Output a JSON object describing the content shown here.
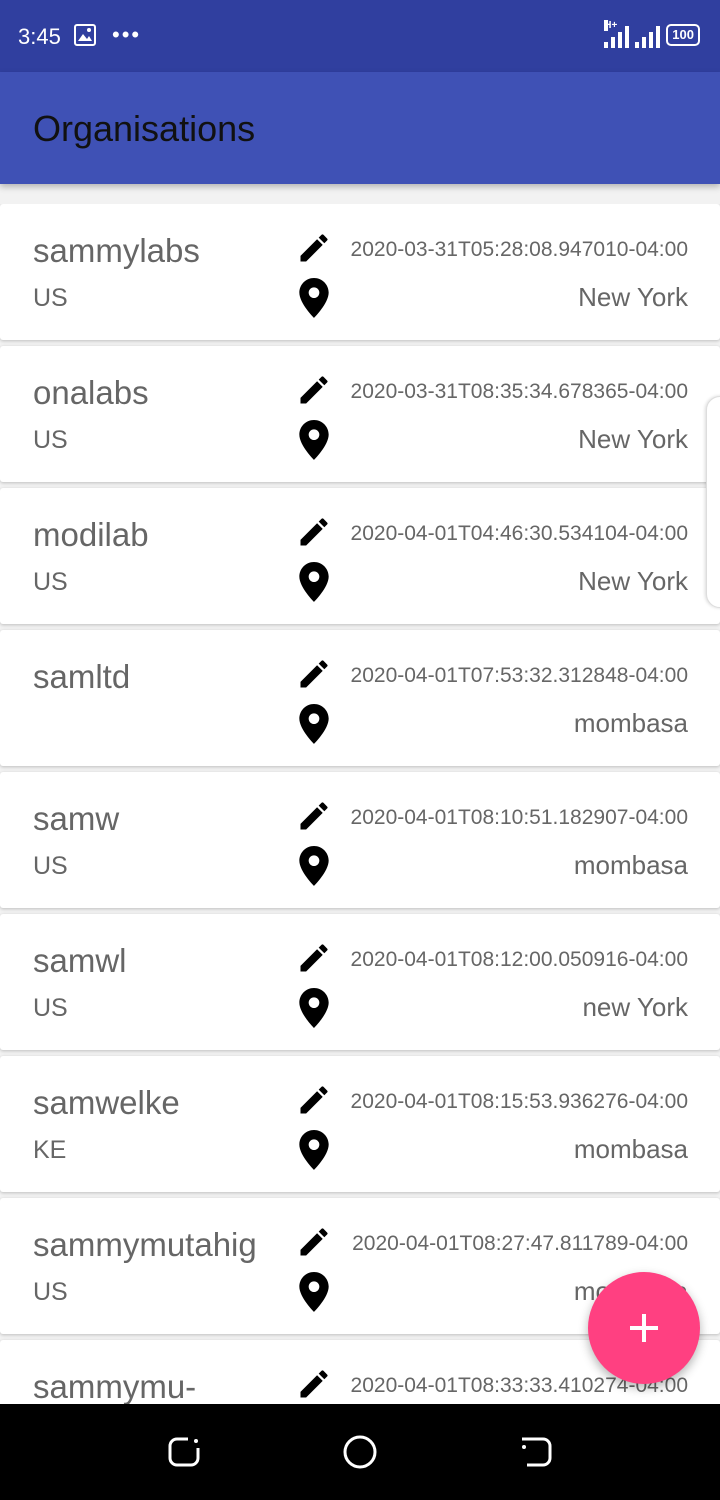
{
  "status_bar": {
    "time": "3:45",
    "dots": "•••",
    "network_type": "H+",
    "battery": "100"
  },
  "app_bar": {
    "title": "Organisations"
  },
  "organisations": [
    {
      "name": "sammylabs",
      "country": "US",
      "timestamp": "2020-03-31T05:28:08.947010-04:00",
      "location": "New York"
    },
    {
      "name": "onalabs",
      "country": "US",
      "timestamp": "2020-03-31T08:35:34.678365-04:00",
      "location": "New York"
    },
    {
      "name": "modilab",
      "country": "US",
      "timestamp": "2020-04-01T04:46:30.534104-04:00",
      "location": "New York"
    },
    {
      "name": "samltd",
      "country": "",
      "timestamp": "2020-04-01T07:53:32.312848-04:00",
      "location": "mombasa"
    },
    {
      "name": "samw",
      "country": "US",
      "timestamp": "2020-04-01T08:10:51.182907-04:00",
      "location": "mombasa"
    },
    {
      "name": "samwl",
      "country": "US",
      "timestamp": "2020-04-01T08:12:00.050916-04:00",
      "location": "new York"
    },
    {
      "name": "samwelke",
      "country": "KE",
      "timestamp": "2020-04-01T08:15:53.936276-04:00",
      "location": "mombasa"
    },
    {
      "name": "sammymutahig",
      "country": "US",
      "timestamp": "2020-04-01T08:27:47.811789-04:00",
      "location": "mombasa"
    },
    {
      "name": "sammymu-",
      "country": "",
      "timestamp": "2020-04-01T08:33:33.410274-04:00",
      "location": ""
    }
  ],
  "icons": {
    "edit": "pencil-icon",
    "location": "map-pin-icon",
    "fab": "plus-icon",
    "nav": [
      "back-icon",
      "home-icon",
      "recents-icon"
    ]
  },
  "colors": {
    "status_bar": "#303f9f",
    "app_bar": "#3f51b5",
    "fab": "#ff4081",
    "text_secondary": "#666666"
  }
}
